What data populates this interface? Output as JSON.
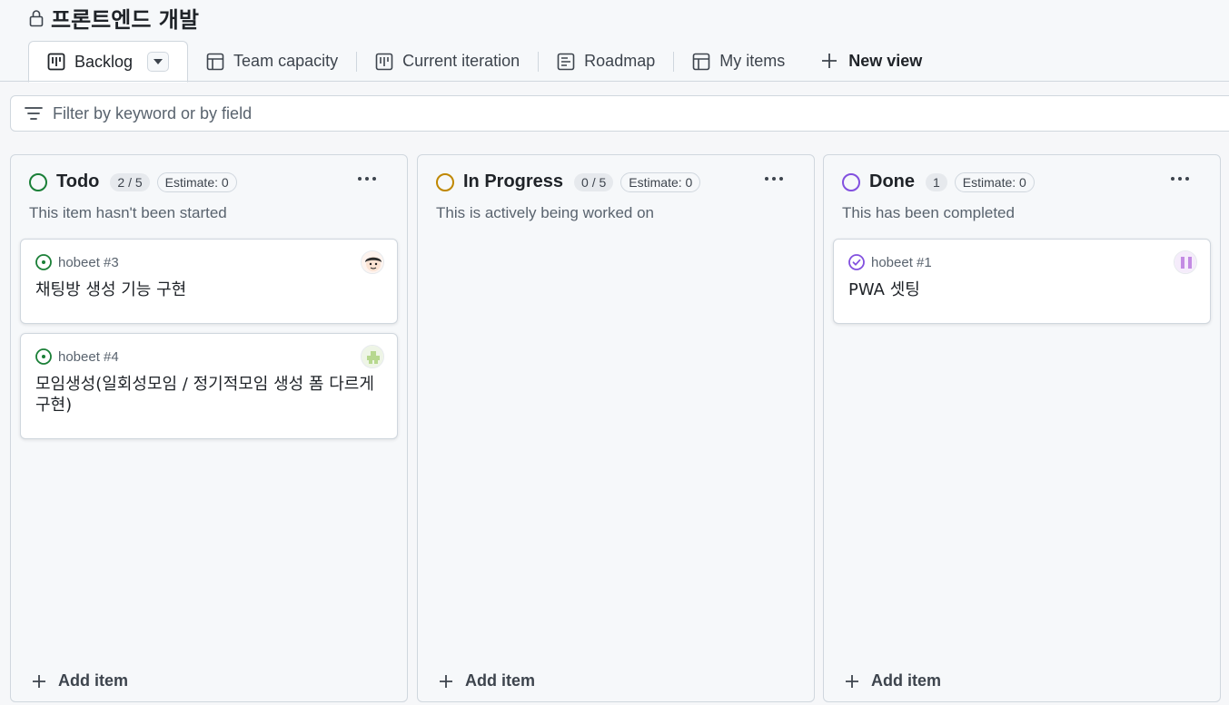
{
  "project": {
    "title": "프론트엔드 개발"
  },
  "tabs": [
    {
      "label": "Backlog",
      "icon": "board-icon",
      "active": true
    },
    {
      "label": "Team capacity",
      "icon": "table-icon"
    },
    {
      "label": "Current iteration",
      "icon": "board-icon"
    },
    {
      "label": "Roadmap",
      "icon": "roadmap-icon"
    },
    {
      "label": "My items",
      "icon": "table-icon"
    }
  ],
  "new_view_label": "New view",
  "filter": {
    "placeholder": "Filter by keyword or by field"
  },
  "columns": [
    {
      "name": "Todo",
      "count": "2 / 5",
      "estimate": "Estimate: 0",
      "description": "This item hasn't been started",
      "color": "#1a7f37",
      "add_label": "Add item",
      "cards": [
        {
          "ref": "hobeet #3",
          "title": "채팅방 생성 기능 구현"
        },
        {
          "ref": "hobeet #4",
          "title": "모임생성(일회성모임 / 정기적모임 생성 폼 다르게 구현)"
        }
      ]
    },
    {
      "name": "In Progress",
      "count": "0 / 5",
      "estimate": "Estimate: 0",
      "description": "This is actively being worked on",
      "color": "#bf8700",
      "add_label": "Add item",
      "cards": []
    },
    {
      "name": "Done",
      "count": "1",
      "estimate": "Estimate: 0",
      "description": "This has been completed",
      "color": "#8250df",
      "add_label": "Add item",
      "cards": [
        {
          "ref": "hobeet #1",
          "title": "PWA 셋팅"
        }
      ]
    }
  ],
  "colors": {
    "open_issue": "#1a7f37",
    "closed_issue": "#8250df",
    "border": "#d0d7de"
  }
}
